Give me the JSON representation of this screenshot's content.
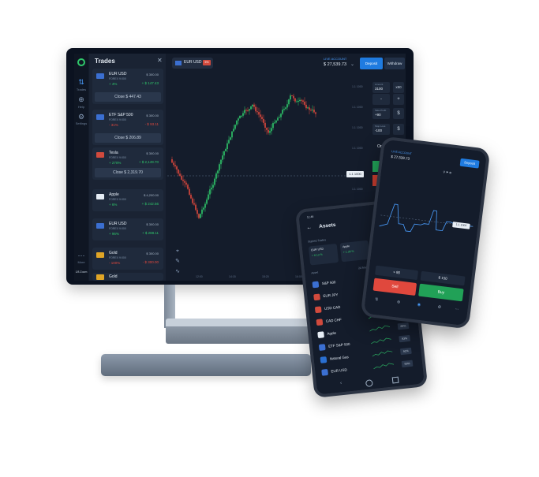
{
  "desktop": {
    "trades_panel": {
      "title": "Trades",
      "close_icon": "close-icon",
      "cards": [
        {
          "name": "EUR USD",
          "sub": "FOREX 9:000",
          "pct": "+ 4%",
          "pct_class": "pos",
          "amt1": "$ 300.00",
          "amt2": "+ $ 147.43",
          "amt2_class": "pos",
          "close": "Close $ 447.43"
        },
        {
          "name": "ETF S&P 500",
          "sub": "FOREX 9:000",
          "pct": "- 31%",
          "pct_class": "neg",
          "amt1": "$ 300.00",
          "amt2": "- $ 93.11",
          "amt2_class": "neg",
          "close": "Close $ 206.89"
        },
        {
          "name": "Tesla",
          "sub": "FOREX 9:000",
          "pct": "+ 270%",
          "pct_class": "pos",
          "amt1": "$ 300.00",
          "amt2": "+ $ 2,149.70",
          "amt2_class": "pos",
          "close": "Close $ 2,319.70"
        },
        {
          "name": "Apple",
          "sub": "FOREX 9:000",
          "pct": "+ 6%",
          "pct_class": "pos",
          "amt1": "$ 4,200.00",
          "amt2": "+ $ 242.56",
          "amt2_class": "pos"
        },
        {
          "name": "EUR USD",
          "sub": "FOREX 9:000",
          "pct": "+ 96%",
          "pct_class": "pos",
          "amt1": "$ 300.00",
          "amt2": "+ $ 288.11",
          "amt2_class": "pos"
        },
        {
          "name": "Gold",
          "sub": "FOREX 9:000",
          "pct": "- 100%",
          "pct_class": "neg",
          "amt1": "$ 300.00",
          "amt2": "- $ 300.00",
          "amt2_class": "neg"
        },
        {
          "name": "Gold",
          "sub": "",
          "pct": "",
          "pct_class": "pos",
          "amt1": "",
          "amt2": "",
          "amt2_class": "pos"
        }
      ]
    },
    "sidebar": {
      "items": [
        {
          "icon": "trades-icon",
          "label": "Trades"
        },
        {
          "icon": "help-icon",
          "label": "Help"
        },
        {
          "icon": "settings-icon",
          "label": "Settings"
        },
        {
          "icon": "more-icon",
          "label": "More"
        }
      ],
      "footer": "1/8 Zoom"
    },
    "topbar": {
      "pair": "EUR USD",
      "pair_badge": "5%",
      "account_label": "LIVE ACCOUNT",
      "account_value": "$ 27,539.73",
      "deposit": "Deposit",
      "withdraw": "Withdraw"
    },
    "order_panel": {
      "amount_label": "Amount",
      "amount_value": "3100",
      "mult_value": "x50",
      "take_profit_label": "Take Profit",
      "take_profit_value": "+90",
      "stop_loss_label": "Stop Loss",
      "stop_loss_value": "-100",
      "order_label": "Order",
      "plus": "+",
      "minus": "-",
      "dollar": "$"
    },
    "price_axis": [
      "1.1 1000",
      "1.1 1000",
      "1.1 1000",
      "1.1 1000",
      "1.1 1000",
      "1.1 1000",
      "1.1 1000"
    ],
    "price_tag": "1.1 1000",
    "time_axis": [
      "12:00",
      "14:15",
      "15:20",
      "16:00"
    ],
    "colors": {
      "up": "#2fc86b",
      "down": "#e0483d",
      "accent": "#1f7be0",
      "bg": "#141c2b"
    }
  },
  "phone_assets": {
    "status_time": "11:48",
    "title": "Assets",
    "section": "Started Trades",
    "tiles": [
      {
        "name": "EUR USD",
        "val": "+ 8.13 %"
      },
      {
        "name": "Apple",
        "val": "+ 1.38 %"
      },
      {
        "name": "Micros",
        "val": ""
      }
    ],
    "list_header_left": "Asset",
    "list_header_mid": "24 hours",
    "list_header_right": "Profit",
    "rows": [
      {
        "name": "S&P 500",
        "pct": "93%"
      },
      {
        "name": "EUR JPY",
        "pct": "91%"
      },
      {
        "name": "USD CAD",
        "pct": "90%"
      },
      {
        "name": "CAD CHF",
        "pct": "93%"
      },
      {
        "name": "Apple",
        "pct": "89%"
      },
      {
        "name": "ETF S&P 500",
        "pct": "93%"
      },
      {
        "name": "Natural Gas",
        "pct": "91%"
      },
      {
        "name": "EUR USD",
        "pct": "93%"
      }
    ]
  },
  "phone_chart": {
    "account_label": "LIVE ACCOUNT",
    "account_value": "$ 27,539.73",
    "deposit": "Deposit",
    "price_tag": "1.1 1000",
    "tp_value": "+ 90",
    "amount_value": "$ 150",
    "sell": "Sell",
    "buy": "Buy"
  }
}
